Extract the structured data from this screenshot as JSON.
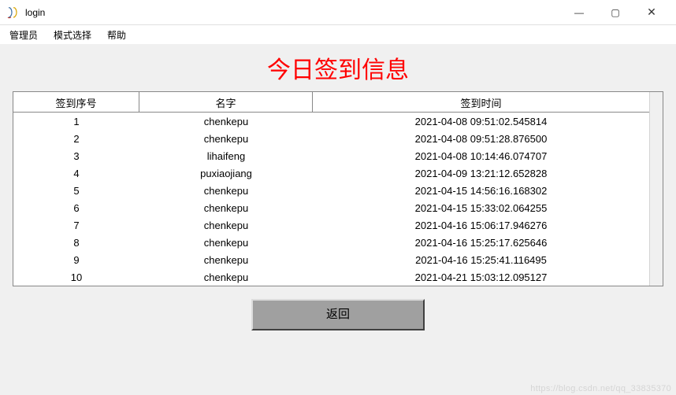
{
  "window": {
    "title": "login",
    "controls": {
      "minimize": "—",
      "maximize": "▢",
      "close": "✕"
    }
  },
  "menu": {
    "items": [
      {
        "label": "管理员"
      },
      {
        "label": "模式选择"
      },
      {
        "label": "帮助"
      }
    ]
  },
  "heading": "今日签到信息",
  "table": {
    "headers": {
      "index": "签到序号",
      "name": "名字",
      "time": "签到时间"
    },
    "rows": [
      {
        "index": "1",
        "name": "chenkepu",
        "time": "2021-04-08 09:51:02.545814"
      },
      {
        "index": "2",
        "name": "chenkepu",
        "time": "2021-04-08 09:51:28.876500"
      },
      {
        "index": "3",
        "name": "lihaifeng",
        "time": "2021-04-08 10:14:46.074707"
      },
      {
        "index": "4",
        "name": "puxiaojiang",
        "time": "2021-04-09 13:21:12.652828"
      },
      {
        "index": "5",
        "name": "chenkepu",
        "time": "2021-04-15 14:56:16.168302"
      },
      {
        "index": "6",
        "name": "chenkepu",
        "time": "2021-04-15 15:33:02.064255"
      },
      {
        "index": "7",
        "name": "chenkepu",
        "time": "2021-04-16 15:06:17.946276"
      },
      {
        "index": "8",
        "name": "chenkepu",
        "time": "2021-04-16 15:25:17.625646"
      },
      {
        "index": "9",
        "name": "chenkepu",
        "time": "2021-04-16 15:25:41.116495"
      },
      {
        "index": "10",
        "name": "chenkepu",
        "time": "2021-04-21 15:03:12.095127"
      }
    ]
  },
  "buttons": {
    "back": "返回"
  },
  "watermark": "https://blog.csdn.net/qq_33835370"
}
